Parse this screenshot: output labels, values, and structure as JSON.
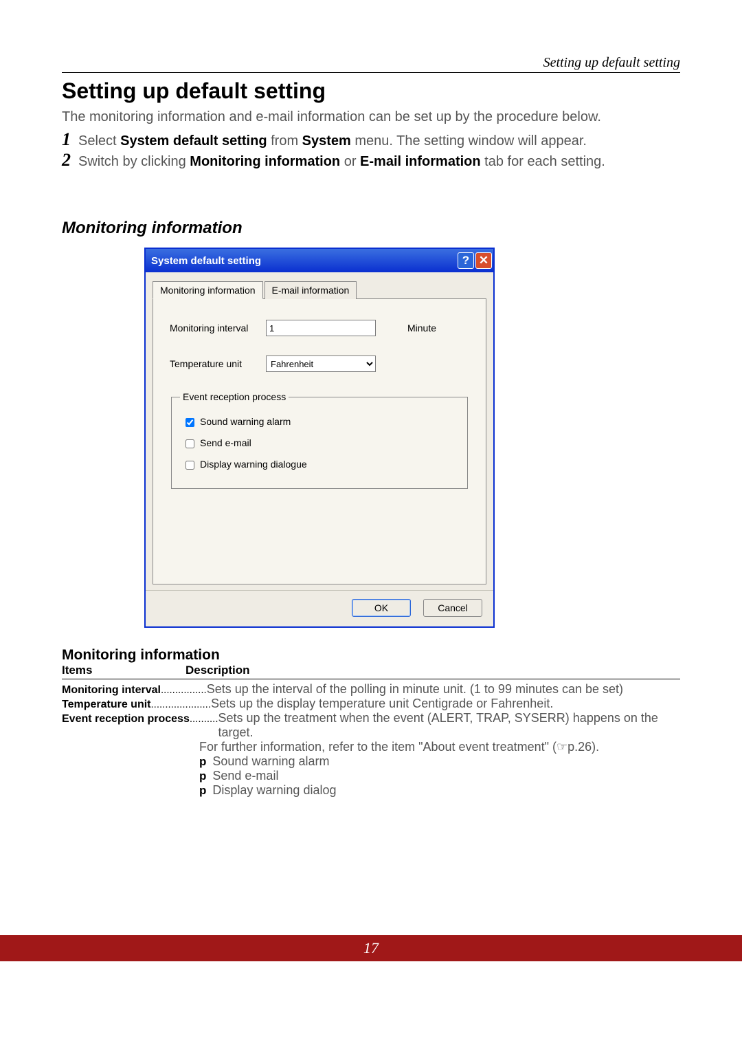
{
  "header_right": "Setting up default setting",
  "title": "Setting up default setting",
  "intro": "The monitoring information and e-mail information can be set up by the procedure below.",
  "steps": [
    {
      "n": "1",
      "pre": "Select ",
      "b1": "System default setting",
      "mid": " from ",
      "b2": "System",
      "post": " menu. The setting window will appear."
    },
    {
      "n": "2",
      "pre": "Switch by clicking ",
      "b1": "Monitoring information",
      "mid": " or ",
      "b2": "E-mail information",
      "post": " tab for each setting."
    }
  ],
  "section_title": "Monitoring information",
  "dialog": {
    "title": "System default setting",
    "tabs": [
      "Monitoring information",
      "E-mail information"
    ],
    "interval_label": "Monitoring interval",
    "interval_value": "1",
    "interval_unit": "Minute",
    "temp_label": "Temperature unit",
    "temp_value": "Fahrenheit",
    "group_legend": "Event reception process",
    "chk1": "Sound warning alarm",
    "chk2": "Send e-mail",
    "chk3": "Display warning dialogue",
    "ok": "OK",
    "cancel": "Cancel"
  },
  "sub_heading": "Monitoring information",
  "col_items": "Items",
  "col_desc": "Description",
  "rows": {
    "r1_label": "Monitoring interval",
    "r1_dots": " ................",
    "r1_val": "Sets up the interval of the polling in minute unit. (1 to 99 minutes can be set)",
    "r2_label": "Temperature unit",
    "r2_dots": " .....................",
    "r2_val": "Sets up the display temperature unit Centigrade or Fahrenheit.",
    "r3_label": "Event reception process",
    "r3_dots": "..........",
    "r3_val": "Sets up the treatment when the event (ALERT, TRAP, SYSERR) happens on the target.",
    "r3_sub": "For further information, refer to the item \"About event treatment\" (☞p.26).",
    "b_marker": "p",
    "b1": " Sound warning alarm",
    "b2": " Send e-mail",
    "b3": " Display warning dialog"
  },
  "page_number": "17"
}
